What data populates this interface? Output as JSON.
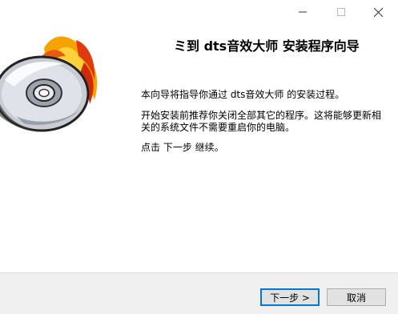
{
  "window": {
    "minimize_icon": "minimize-icon",
    "maximize_icon": "maximize-icon",
    "close_icon": "close-icon"
  },
  "hero": {
    "image_icon": "cd-fire-icon"
  },
  "content": {
    "heading": "ミ到 dts音效大师 安装程序向导",
    "paragraph1": "本向导将指导你通过 dts音效大师 的安装过程。",
    "paragraph2": "开始安装前推荐你关闭全部其它的程序。这将能够更新相关的系统文件不需要重启你的电脑。",
    "paragraph3": "点击 下一步 继续。"
  },
  "buttons": {
    "next": "下一步 >",
    "cancel": "取消"
  },
  "colors": {
    "bottom_bar": "#f0f0f0",
    "focus_border": "#0078d7"
  }
}
